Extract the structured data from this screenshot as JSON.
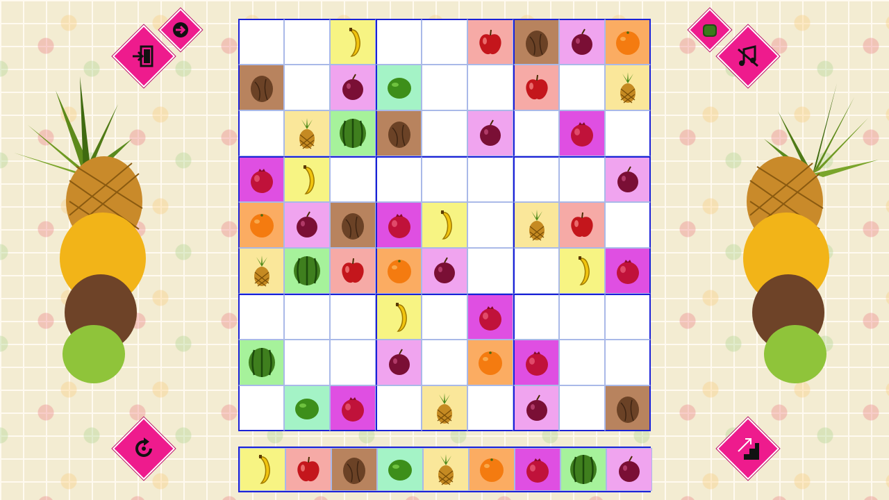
{
  "palette": {
    "banana": "#f7f483",
    "apple": "#f6aaa6",
    "coconut": "#b8835e",
    "plum": "#f0a4ef",
    "lime": "#a4f3c6",
    "pineapple": "#fae79a",
    "orange": "#fbac62",
    "watermelon": "#a6f29b",
    "pomegranate": "#df4fe2"
  },
  "grid": [
    [
      null,
      null,
      "banana",
      null,
      null,
      "apple",
      "coconut",
      "plum",
      "orange"
    ],
    [
      "coconut",
      null,
      "plum",
      "lime",
      null,
      null,
      "apple",
      null,
      "pineapple"
    ],
    [
      null,
      "pineapple",
      "watermelon",
      "coconut",
      null,
      "plum",
      null,
      "pomegranate",
      null
    ],
    [
      "pomegranate",
      "banana",
      null,
      null,
      null,
      null,
      null,
      null,
      "plum"
    ],
    [
      "orange",
      "plum",
      "coconut",
      "pomegranate",
      "banana",
      null,
      "pineapple",
      "apple",
      null
    ],
    [
      "pineapple",
      "watermelon",
      "apple",
      "orange",
      "plum",
      null,
      null,
      "banana",
      "pomegranate"
    ],
    [
      null,
      null,
      null,
      "banana",
      null,
      "pomegranate",
      null,
      null,
      null
    ],
    [
      "watermelon",
      null,
      null,
      "plum",
      null,
      "orange",
      "pomegranate",
      null,
      null
    ],
    [
      null,
      "lime",
      "pomegranate",
      null,
      "pineapple",
      null,
      "plum",
      null,
      "coconut"
    ]
  ],
  "tray": [
    "banana",
    "apple",
    "coconut",
    "lime",
    "pineapple",
    "orange",
    "pomegranate",
    "watermelon",
    "plum"
  ],
  "buttons": {
    "exit": "exit-door-icon",
    "next": "arrow-right-icon",
    "undo": "undo-icon",
    "hint": "stairs-arrow-icon",
    "fruit_mode": "green-fruit-icon",
    "sound": "music-mute-icon"
  }
}
